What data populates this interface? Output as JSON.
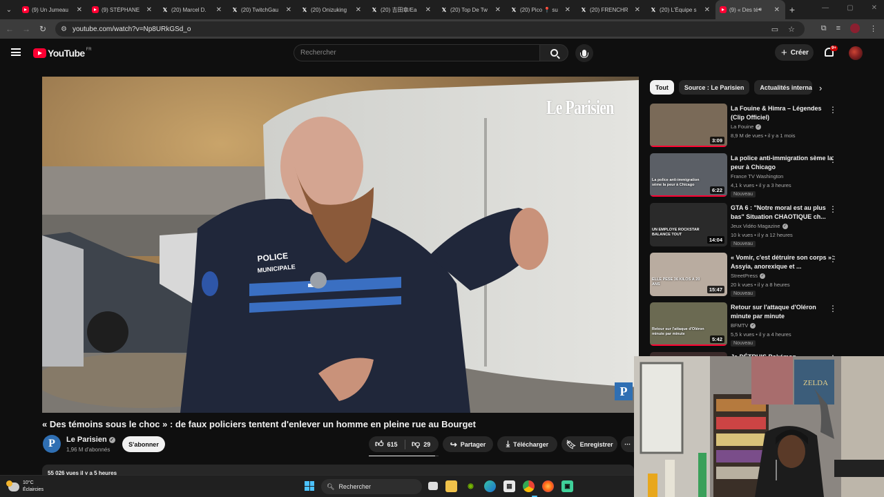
{
  "browser": {
    "tabs": [
      {
        "title": "(9) Un Jumeau",
        "icon": "youtube"
      },
      {
        "title": "(9) STÉPHANE",
        "icon": "youtube"
      },
      {
        "title": "(20) Marcel D.",
        "icon": "x"
      },
      {
        "title": "(20) TwitchGau",
        "icon": "x"
      },
      {
        "title": "(20) Onizuking",
        "icon": "x"
      },
      {
        "title": "(20) 吉田章/Ea",
        "icon": "x"
      },
      {
        "title": "(20) Top De Tw",
        "icon": "x"
      },
      {
        "title": "(20) Pico 📍 su",
        "icon": "x"
      },
      {
        "title": "(20) FRENCHR",
        "icon": "x"
      },
      {
        "title": "(20) L'Équipe s",
        "icon": "x"
      },
      {
        "title": "(9) « Des té",
        "icon": "youtube",
        "active": true,
        "audio": true
      }
    ],
    "url": "youtube.com/watch?v=Np8URkGSd_o"
  },
  "youtube": {
    "logo_text": "YouTube",
    "country": "FR",
    "search_placeholder": "Rechercher",
    "create_label": "Créer",
    "notif_count": "9+"
  },
  "video": {
    "watermark": "Le Parisien",
    "badge_letter": "P",
    "title": "« Des témoins sous le choc » : de faux policiers tentent d'enlever un homme en pleine rue au Bourget",
    "channel": "Le Parisien",
    "channel_initial": "P",
    "subscribers": "1,96 M d'abonnés",
    "subscribe_label": "S'abonner",
    "likes": "615",
    "dislikes": "29",
    "like_ratio": 0.955,
    "share_label": "Partager",
    "download_label": "Télécharger",
    "save_label": "Enregistrer",
    "views_date": "55 026 vues  il y a 5 heures",
    "uniform_text": "POLICE MUNICIPALE"
  },
  "chips": [
    "Tout",
    "Source : Le Parisien",
    "Actualités internat"
  ],
  "recommendations": [
    {
      "title": "La Fouine & Himra – Légendes (Clip Officiel)",
      "channel": "La Fouine",
      "verified": true,
      "meta": "8,9 M de vues • il y a 1 mois",
      "duration": "3:09",
      "is_new": false,
      "thumb_color": "#7a6a58"
    },
    {
      "title": "La police anti-immigration sème la peur à Chicago",
      "channel": "France TV Washington",
      "verified": false,
      "meta": "4,1 k vues • il y a 3 heures",
      "duration": "6:22",
      "is_new": true,
      "thumb_color": "#5b5f66"
    },
    {
      "title": "GTA 6 : \"Notre moral est au plus bas\" Situation CHAOTIQUE ch...",
      "channel": "Jeux Vidéo Magazine",
      "verified": true,
      "meta": "10 k vues • il y a 12 heures",
      "duration": "14:04",
      "is_new": true,
      "thumb_color": "#2a2a2a"
    },
    {
      "title": "« Vomir, c'est détruire son corps » : Assyia, anorexique et ...",
      "channel": "StreetPress",
      "verified": true,
      "meta": "20 k vues • il y a 8 heures",
      "duration": "15:47",
      "is_new": true,
      "thumb_color": "#b9aca0"
    },
    {
      "title": "Retour sur l'attaque d'Oléron minute par minute",
      "channel": "BFMTV",
      "verified": true,
      "meta": "5,5 k vues • il y a 4 heures",
      "duration": "5:42",
      "is_new": true,
      "thumb_color": "#6b6a52"
    },
    {
      "title": "Je DÉTRUIS Pokémon",
      "channel": "",
      "verified": false,
      "meta": "",
      "duration": "",
      "is_new": false,
      "thumb_color": "#3a2a2a"
    }
  ],
  "reco_thumb_texts": [
    "",
    "La police anti-immigration sème la peur à Chicago",
    "UN EMPLOYÉ ROCKSTAR BALANCE TOUT",
    "ELLE PÈSE 36 KILOS À 20 ANS",
    "Retour sur l'attaque d'Oléron minute par minute",
    ""
  ],
  "taskbar": {
    "temperature": "10°C",
    "weather": "Éclaircies",
    "search_label": "Rechercher"
  }
}
